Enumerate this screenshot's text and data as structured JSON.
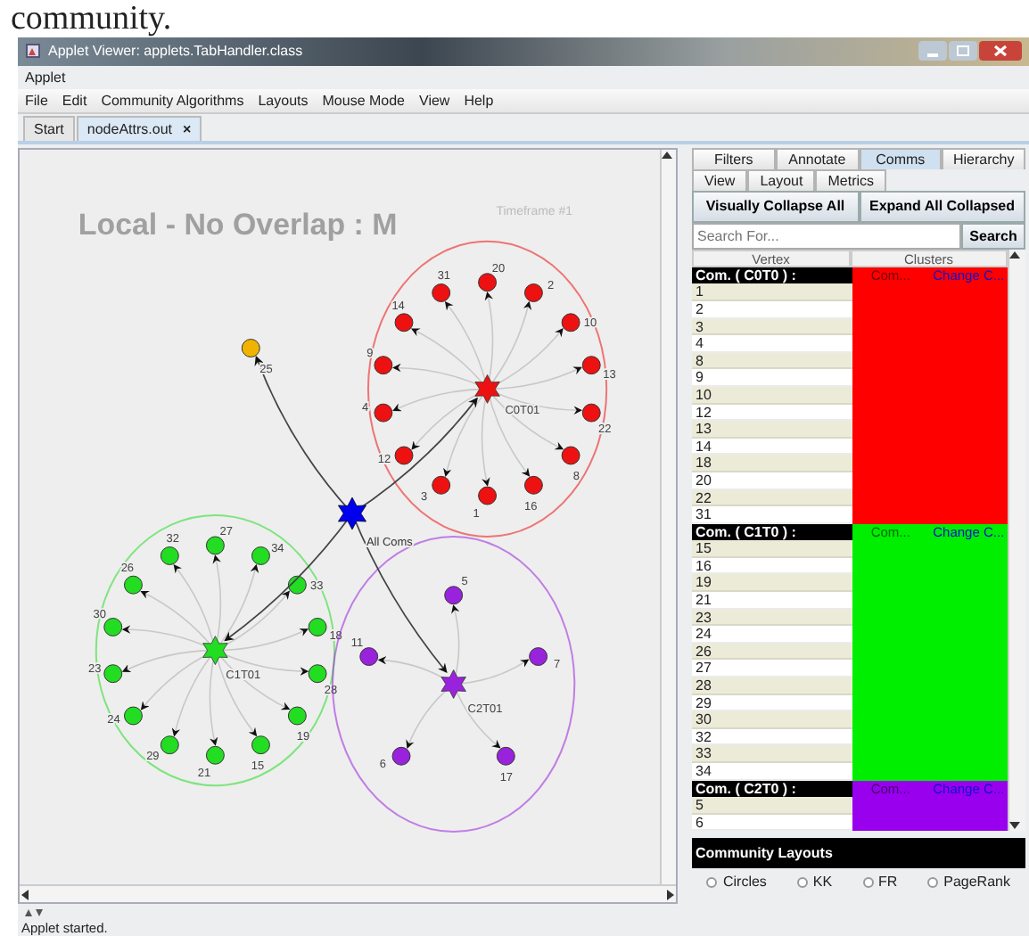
{
  "caption_fragment": "community.",
  "window": {
    "title": "Applet Viewer: applets.TabHandler.class",
    "applet_menu": "Applet"
  },
  "menu": [
    "File",
    "Edit",
    "Community Algorithms",
    "Layouts",
    "Mouse Mode",
    "View",
    "Help"
  ],
  "doc_tabs": [
    {
      "label": "Start",
      "selected": false
    },
    {
      "label": "nodeAttrs.out",
      "selected": true,
      "close": "×"
    }
  ],
  "canvas": {
    "title": "Local - No Overlap : M",
    "timeframe": "Timeframe #1",
    "hub": {
      "label": "All Coms",
      "color": "#0000ee"
    },
    "outlier": {
      "label": "25",
      "color": "#f0b400"
    },
    "communities": [
      {
        "label": "C0T01",
        "color": "#ee1111",
        "members": [
          "20",
          "2",
          "10",
          "13",
          "22",
          "8",
          "16",
          "1",
          "3",
          "12",
          "4",
          "9",
          "14",
          "31"
        ]
      },
      {
        "label": "C1T01",
        "color": "#22dd22",
        "members": [
          "27",
          "34",
          "33",
          "18",
          "28",
          "19",
          "15",
          "21",
          "29",
          "24",
          "23",
          "30",
          "26",
          "32"
        ]
      },
      {
        "label": "C2T01",
        "color": "#9922dd",
        "members": [
          "5",
          "7",
          "17",
          "6",
          "11"
        ]
      }
    ]
  },
  "panel": {
    "tab_rows": [
      [
        {
          "label": "Filters",
          "selected": false
        },
        {
          "label": "Annotate",
          "selected": false
        },
        {
          "label": "Comms",
          "selected": true
        },
        {
          "label": "Hierarchy",
          "selected": false
        }
      ],
      [
        {
          "label": "View",
          "selected": false
        },
        {
          "label": "Layout",
          "selected": false
        },
        {
          "label": "Metrics",
          "selected": false
        }
      ]
    ],
    "buttons": [
      "Visually Collapse All",
      "Expand All Collapsed"
    ],
    "search": {
      "placeholder": "Search For...",
      "button": "Search"
    },
    "table": {
      "columns": [
        "Vertex",
        "Clusters"
      ],
      "groups": [
        {
          "label": "Com. ( C0T0 ) :",
          "color": "#ff0000",
          "actions": [
            "Com...",
            "Change C..."
          ],
          "rows": [
            "1",
            "2",
            "3",
            "4",
            "8",
            "9",
            "10",
            "12",
            "13",
            "14",
            "18",
            "20",
            "22",
            "31"
          ]
        },
        {
          "label": "Com. ( C1T0 ) :",
          "color": "#00ee00",
          "actions": [
            "Com...",
            "Change C..."
          ],
          "rows": [
            "15",
            "16",
            "19",
            "21",
            "23",
            "24",
            "26",
            "27",
            "28",
            "29",
            "30",
            "32",
            "33",
            "34"
          ]
        },
        {
          "label": "Com. ( C2T0 ) :",
          "color": "#9900ee",
          "actions": [
            "Com...",
            "Change C..."
          ],
          "rows": [
            "5",
            "6"
          ]
        }
      ]
    },
    "layouts": {
      "title": "Community Layouts",
      "options": [
        {
          "label": "Circles",
          "selected": false
        },
        {
          "label": "KK",
          "selected": false
        },
        {
          "label": "FR",
          "selected": false
        },
        {
          "label": "PageRank",
          "selected": false
        }
      ]
    }
  },
  "status_bar": "Applet started."
}
